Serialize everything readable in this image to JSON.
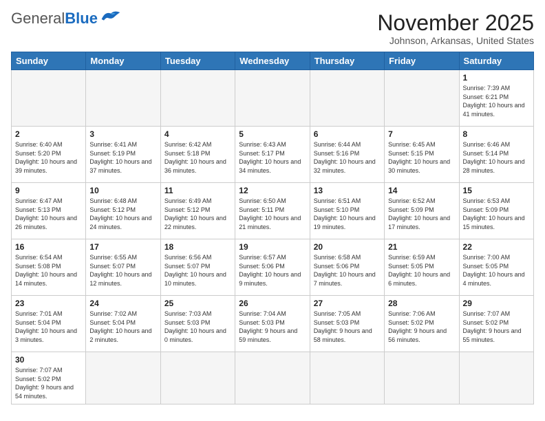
{
  "header": {
    "logo_general": "General",
    "logo_blue": "Blue",
    "month_title": "November 2025",
    "location": "Johnson, Arkansas, United States"
  },
  "days_of_week": [
    "Sunday",
    "Monday",
    "Tuesday",
    "Wednesday",
    "Thursday",
    "Friday",
    "Saturday"
  ],
  "weeks": [
    [
      {
        "day": "",
        "info": ""
      },
      {
        "day": "",
        "info": ""
      },
      {
        "day": "",
        "info": ""
      },
      {
        "day": "",
        "info": ""
      },
      {
        "day": "",
        "info": ""
      },
      {
        "day": "",
        "info": ""
      },
      {
        "day": "1",
        "info": "Sunrise: 7:39 AM\nSunset: 6:21 PM\nDaylight: 10 hours and 41 minutes."
      }
    ],
    [
      {
        "day": "2",
        "info": "Sunrise: 6:40 AM\nSunset: 5:20 PM\nDaylight: 10 hours and 39 minutes."
      },
      {
        "day": "3",
        "info": "Sunrise: 6:41 AM\nSunset: 5:19 PM\nDaylight: 10 hours and 37 minutes."
      },
      {
        "day": "4",
        "info": "Sunrise: 6:42 AM\nSunset: 5:18 PM\nDaylight: 10 hours and 36 minutes."
      },
      {
        "day": "5",
        "info": "Sunrise: 6:43 AM\nSunset: 5:17 PM\nDaylight: 10 hours and 34 minutes."
      },
      {
        "day": "6",
        "info": "Sunrise: 6:44 AM\nSunset: 5:16 PM\nDaylight: 10 hours and 32 minutes."
      },
      {
        "day": "7",
        "info": "Sunrise: 6:45 AM\nSunset: 5:15 PM\nDaylight: 10 hours and 30 minutes."
      },
      {
        "day": "8",
        "info": "Sunrise: 6:46 AM\nSunset: 5:14 PM\nDaylight: 10 hours and 28 minutes."
      }
    ],
    [
      {
        "day": "9",
        "info": "Sunrise: 6:47 AM\nSunset: 5:13 PM\nDaylight: 10 hours and 26 minutes."
      },
      {
        "day": "10",
        "info": "Sunrise: 6:48 AM\nSunset: 5:12 PM\nDaylight: 10 hours and 24 minutes."
      },
      {
        "day": "11",
        "info": "Sunrise: 6:49 AM\nSunset: 5:12 PM\nDaylight: 10 hours and 22 minutes."
      },
      {
        "day": "12",
        "info": "Sunrise: 6:50 AM\nSunset: 5:11 PM\nDaylight: 10 hours and 21 minutes."
      },
      {
        "day": "13",
        "info": "Sunrise: 6:51 AM\nSunset: 5:10 PM\nDaylight: 10 hours and 19 minutes."
      },
      {
        "day": "14",
        "info": "Sunrise: 6:52 AM\nSunset: 5:09 PM\nDaylight: 10 hours and 17 minutes."
      },
      {
        "day": "15",
        "info": "Sunrise: 6:53 AM\nSunset: 5:09 PM\nDaylight: 10 hours and 15 minutes."
      }
    ],
    [
      {
        "day": "16",
        "info": "Sunrise: 6:54 AM\nSunset: 5:08 PM\nDaylight: 10 hours and 14 minutes."
      },
      {
        "day": "17",
        "info": "Sunrise: 6:55 AM\nSunset: 5:07 PM\nDaylight: 10 hours and 12 minutes."
      },
      {
        "day": "18",
        "info": "Sunrise: 6:56 AM\nSunset: 5:07 PM\nDaylight: 10 hours and 10 minutes."
      },
      {
        "day": "19",
        "info": "Sunrise: 6:57 AM\nSunset: 5:06 PM\nDaylight: 10 hours and 9 minutes."
      },
      {
        "day": "20",
        "info": "Sunrise: 6:58 AM\nSunset: 5:06 PM\nDaylight: 10 hours and 7 minutes."
      },
      {
        "day": "21",
        "info": "Sunrise: 6:59 AM\nSunset: 5:05 PM\nDaylight: 10 hours and 6 minutes."
      },
      {
        "day": "22",
        "info": "Sunrise: 7:00 AM\nSunset: 5:05 PM\nDaylight: 10 hours and 4 minutes."
      }
    ],
    [
      {
        "day": "23",
        "info": "Sunrise: 7:01 AM\nSunset: 5:04 PM\nDaylight: 10 hours and 3 minutes."
      },
      {
        "day": "24",
        "info": "Sunrise: 7:02 AM\nSunset: 5:04 PM\nDaylight: 10 hours and 2 minutes."
      },
      {
        "day": "25",
        "info": "Sunrise: 7:03 AM\nSunset: 5:03 PM\nDaylight: 10 hours and 0 minutes."
      },
      {
        "day": "26",
        "info": "Sunrise: 7:04 AM\nSunset: 5:03 PM\nDaylight: 9 hours and 59 minutes."
      },
      {
        "day": "27",
        "info": "Sunrise: 7:05 AM\nSunset: 5:03 PM\nDaylight: 9 hours and 58 minutes."
      },
      {
        "day": "28",
        "info": "Sunrise: 7:06 AM\nSunset: 5:02 PM\nDaylight: 9 hours and 56 minutes."
      },
      {
        "day": "29",
        "info": "Sunrise: 7:07 AM\nSunset: 5:02 PM\nDaylight: 9 hours and 55 minutes."
      }
    ],
    [
      {
        "day": "30",
        "info": "Sunrise: 7:07 AM\nSunset: 5:02 PM\nDaylight: 9 hours and 54 minutes."
      },
      {
        "day": "",
        "info": ""
      },
      {
        "day": "",
        "info": ""
      },
      {
        "day": "",
        "info": ""
      },
      {
        "day": "",
        "info": ""
      },
      {
        "day": "",
        "info": ""
      },
      {
        "day": "",
        "info": ""
      }
    ]
  ]
}
